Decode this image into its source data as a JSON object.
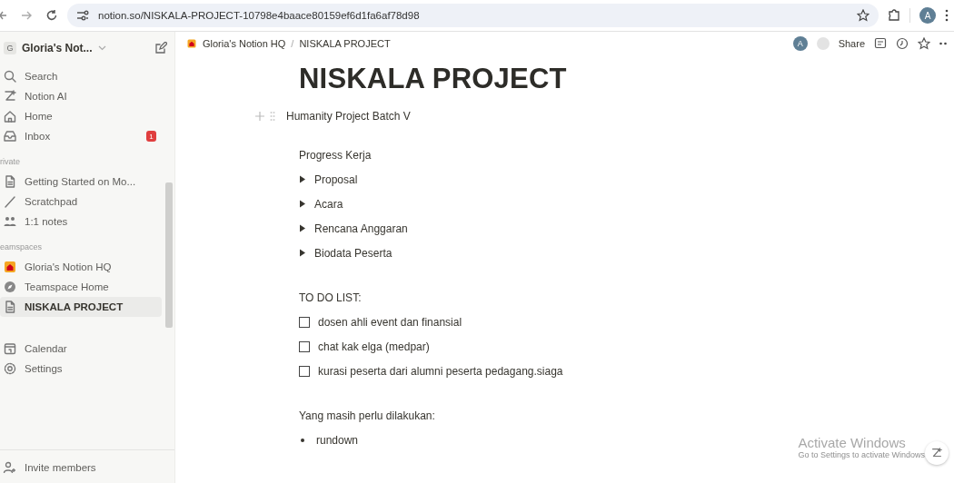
{
  "browser": {
    "url": "notion.so/NISKALA-PROJECT-10798e4baace80159ef6d1fa6af78d98",
    "profile": "A"
  },
  "sidebar": {
    "workspace_initial": "G",
    "workspace": "Gloria's Not...",
    "nav": [
      {
        "label": "Search",
        "selected": false
      },
      {
        "label": "Notion AI",
        "selected": false
      },
      {
        "label": "Home",
        "selected": false
      },
      {
        "label": "Inbox",
        "selected": false,
        "badge": "1"
      }
    ],
    "sections": [
      {
        "heading": "rivate",
        "items": [
          {
            "label": "Getting Started on Mo...",
            "selected": false
          },
          {
            "label": "Scratchpad",
            "selected": false
          },
          {
            "label": "1:1 notes",
            "selected": false
          }
        ]
      },
      {
        "heading": "eamspaces",
        "items": [
          {
            "label": "Gloria's Notion HQ",
            "selected": false
          },
          {
            "label": "Teamspace Home",
            "selected": false
          },
          {
            "label": "NISKALA PROJECT",
            "selected": true
          }
        ]
      }
    ],
    "bottom": [
      {
        "label": "Calendar",
        "selected": false
      },
      {
        "label": "Settings",
        "selected": false
      }
    ],
    "invite": "Invite members"
  },
  "topbar": {
    "breadcrumb": [
      "Gloria's Notion HQ",
      "NISKALA PROJECT"
    ],
    "separator": "/",
    "avatar": "A",
    "share": "Share"
  },
  "page": {
    "title": "NISKALA PROJECT",
    "subtitle": "Humanity Project Batch V",
    "blocks": [
      {
        "kind": "text",
        "text": "Progress Kerja"
      },
      {
        "kind": "toggle",
        "text": "Proposal"
      },
      {
        "kind": "toggle",
        "text": "Acara"
      },
      {
        "kind": "toggle",
        "text": "Rencana Anggaran"
      },
      {
        "kind": "toggle",
        "text": "Biodata Peserta"
      },
      {
        "kind": "text",
        "text": "TO DO LIST:"
      },
      {
        "kind": "todo",
        "checked": false,
        "text": "dosen ahli event dan finansial"
      },
      {
        "kind": "todo",
        "checked": false,
        "text": "chat kak elga (medpar)"
      },
      {
        "kind": "todo",
        "checked": false,
        "text": "kurasi peserta dari alumni peserta pedagang.siaga"
      },
      {
        "kind": "text",
        "text": "Yang masih perlu dilakukan:"
      },
      {
        "kind": "bullet",
        "text": "rundown"
      }
    ]
  },
  "activation": {
    "title": "Activate Windows",
    "text": "Go to Settings to activate Windows"
  }
}
